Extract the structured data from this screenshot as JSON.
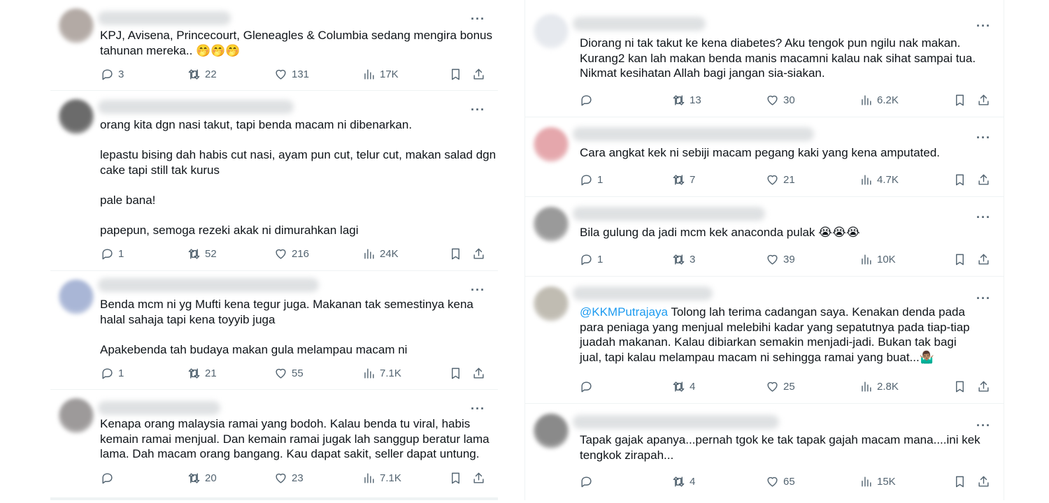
{
  "left": [
    {
      "avatar_color": "#b3aaa5",
      "text": "KPJ, Avisena, Princecourt, Gleneagles & Columbia sedang mengira bonus\ntahunan mereka.. 🤭🤭🤭",
      "replies": "3",
      "reposts": "22",
      "likes": "131",
      "views": "17K"
    },
    {
      "avatar_color": "#6b6b6b",
      "text": "orang kita dgn nasi takut, tapi benda macam ni dibenarkan.\n\nlepastu bising dah habis cut nasi, ayam pun cut, telur cut, makan salad dgn\ncake tapi still tak kurus\n\npale bana!\n\npapepun, semoga rezeki akak ni dimurahkan lagi",
      "replies": "1",
      "reposts": "52",
      "likes": "216",
      "views": "24K"
    },
    {
      "avatar_color": "#a9b6d6",
      "text": "Benda mcm ni yg Mufti kena tegur juga. Makanan tak semestinya kena\nhalal sahaja tapi kena toyyib juga\n\nApakebenda tah budaya makan gula melampau macam ni",
      "replies": "1",
      "reposts": "21",
      "likes": "55",
      "views": "7.1K"
    },
    {
      "avatar_color": "#9d9a9a",
      "text": "Kenapa orang malaysia ramai yang bodoh. Kalau benda tu viral, habis\nkemain ramai menjual. Dan kemain ramai jugak lah sanggup beratur lama\nlama. Dah macam orang bangang. Kau dapat sakit, seller dapat untung.",
      "replies": "",
      "reposts": "20",
      "likes": "23",
      "views": "7.1K"
    }
  ],
  "right": [
    {
      "avatar_color": "#e6e9ee",
      "text": "Diorang ni tak takut ke kena diabetes? Aku tengok pun ngilu nak makan.\nKurang2 kan lah makan benda manis macamni kalau nak sihat sampai tua.\nNikmat kesihatan Allah bagi jangan sia-siakan.",
      "replies": "",
      "reposts": "13",
      "likes": "30",
      "views": "6.2K"
    },
    {
      "avatar_color": "#e5a7ac",
      "text": "Cara angkat kek ni sebiji macam pegang kaki yang kena amputated.",
      "replies": "1",
      "reposts": "7",
      "likes": "21",
      "views": "4.7K"
    },
    {
      "avatar_color": "#9a9a9a",
      "text": "Bila gulung da jadi mcm kek anaconda pulak 😭😭😭",
      "replies": "1",
      "reposts": "3",
      "likes": "39",
      "views": "10K"
    },
    {
      "avatar_color": "#c0bcb2",
      "mention": "@KKMPutrajaya",
      "text": " Tolong lah terima cadangan saya. Kenakan denda pada\npara peniaga yang menjual melebihi kadar yang sepatutnya pada tiap-tiap\njuadah makanan. Kalau dibiarkan semakin menjadi-jadi. Bukan tak bagi\njual, tapi kalau melampau macam ni sehingga ramai yang buat...🤷🏽‍♂️",
      "replies": "",
      "reposts": "4",
      "likes": "25",
      "views": "2.8K"
    },
    {
      "avatar_color": "#8a8a8a",
      "text": "Tapak gajak apanya...pernah tgok ke tak tapak gajah macam mana....ini kek\ntengkok zirapah...",
      "replies": "",
      "reposts": "4",
      "likes": "65",
      "views": "15K"
    }
  ],
  "icons": {
    "reply": "reply-icon",
    "repost": "repost-icon",
    "like": "like-icon",
    "views": "views-icon",
    "bookmark": "bookmark-icon",
    "share": "share-icon",
    "more": "more-icon"
  },
  "colors": {
    "text": "#0f1419",
    "secondary": "#536471",
    "link": "#1d9bf0",
    "divider": "#eff3f4"
  }
}
